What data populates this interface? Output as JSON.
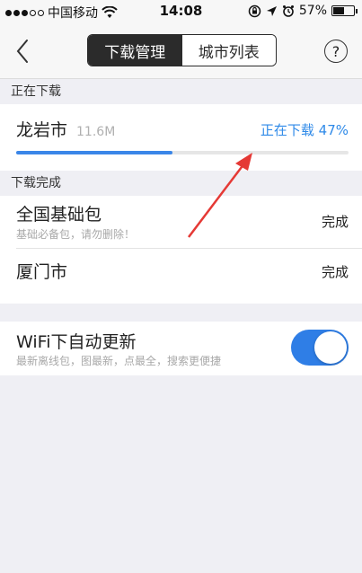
{
  "status_bar": {
    "carrier": "中国移动",
    "time": "14:08",
    "battery_text": "57%",
    "battery_level": 0.57,
    "icons": [
      "signal-dots-icon",
      "wifi-icon",
      "rotation-lock-icon",
      "location-arrow-icon",
      "alarm-icon",
      "battery-icon"
    ]
  },
  "nav": {
    "back_icon": "chevron-left-icon",
    "tabs": [
      {
        "label": "下载管理",
        "active": true
      },
      {
        "label": "城市列表",
        "active": false
      }
    ],
    "help_label": "?"
  },
  "downloading": {
    "header": "正在下载",
    "items": [
      {
        "name": "龙岩市",
        "size": "11.6M",
        "status": "正在下载 47%",
        "progress": 0.47
      }
    ]
  },
  "completed": {
    "header": "下载完成",
    "items": [
      {
        "name": "全国基础包",
        "subtitle": "基础必备包，请勿删除！",
        "status": "完成"
      },
      {
        "name": "厦门市",
        "status": "完成"
      }
    ]
  },
  "wifi_setting": {
    "label": "WiFi下自动更新",
    "subtitle": "最新离线包，图最新，点最全，搜索更便捷",
    "enabled": true
  },
  "colors": {
    "accent": "#2f8ae8",
    "toggle_on": "#2f7ee6",
    "arrow": "#e53935"
  }
}
